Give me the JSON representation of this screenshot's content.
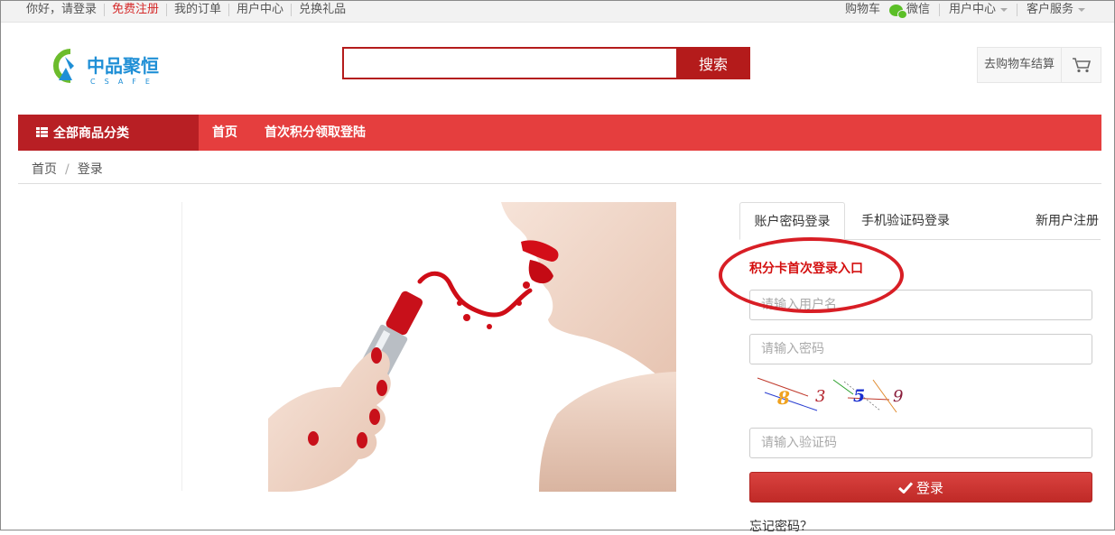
{
  "topbar": {
    "greeting": "你好，请登录",
    "register": "免费注册",
    "my_orders": "我的订单",
    "user_center": "用户中心",
    "redeem": "兑换礼品",
    "cart": "购物车",
    "wechat": "微信",
    "user_center_menu": "用户中心",
    "customer_service": "客户服务"
  },
  "header": {
    "logo_cn": "中品聚恒",
    "logo_en": "CSAFE",
    "search_placeholder": "",
    "search_button": "搜索",
    "cart_checkout": "去购物车结算"
  },
  "nav": {
    "all_categories": "全部商品分类",
    "links": [
      "首页",
      "首次积分领取登陆"
    ]
  },
  "breadcrumb": [
    "首页",
    "登录"
  ],
  "login": {
    "tabs": [
      "账户密码登录",
      "手机验证码登录",
      "新用户注册"
    ],
    "intro": "积分卡首次登录入口",
    "username_placeholder": "请输入用户名",
    "password_placeholder": "请输入密码",
    "captcha_text": "8359",
    "captcha_placeholder": "请输入验证码",
    "submit": "登录",
    "forgot": "忘记密码？"
  },
  "colors": {
    "brand_red": "#b81f24",
    "nav_red": "#e53e3e",
    "intro_red": "#d40f0f",
    "logo_blue": "#1f8fd6",
    "logo_green": "#6cbc2c"
  }
}
